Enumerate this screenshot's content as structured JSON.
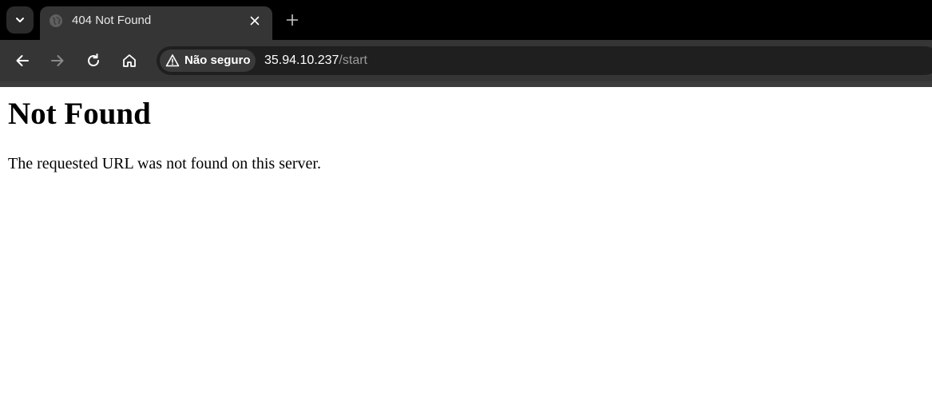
{
  "tab": {
    "title": "404 Not Found",
    "favicon": "globe-icon"
  },
  "toolbar": {
    "security_label": "Não seguro",
    "url_host": "35.94.10.237",
    "url_path": "/start",
    "icons": [
      "back-arrow-icon",
      "forward-arrow-icon",
      "reload-icon",
      "home-icon",
      "warning-icon"
    ]
  },
  "page": {
    "heading": "Not Found",
    "message": "The requested URL was not found on this server."
  },
  "colors": {
    "chrome_background": "#000000",
    "toolbar_background": "#353535",
    "omnibox_background": "#1f1f1f",
    "page_background": "#ffffff"
  }
}
